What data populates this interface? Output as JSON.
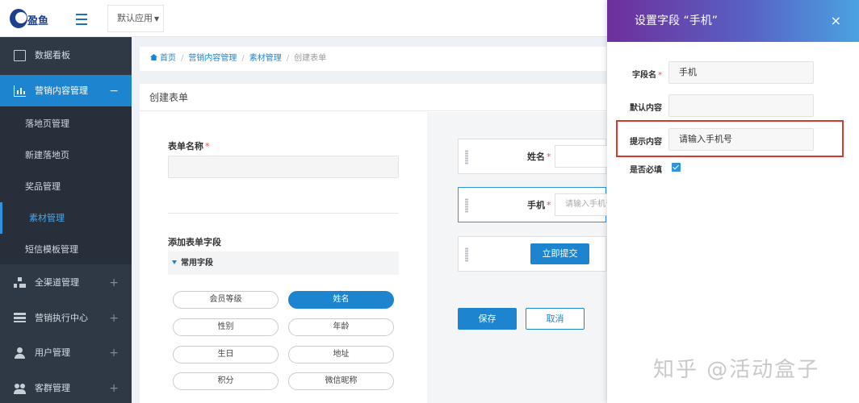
{
  "header": {
    "logo_text": "盈鱼",
    "app_select": "默认应用"
  },
  "sidebar": {
    "items": [
      {
        "label": "数据看板",
        "icon": "monitor-icon"
      },
      {
        "label": "营销内容管理",
        "icon": "chart-icon",
        "toggle": "−"
      },
      {
        "label": "全渠道管理",
        "icon": "sitemap-icon",
        "toggle": "+"
      },
      {
        "label": "营销执行中心",
        "icon": "stack-icon",
        "toggle": "+"
      },
      {
        "label": "用户管理",
        "icon": "user-icon",
        "toggle": "+"
      },
      {
        "label": "客群管理",
        "icon": "group-icon",
        "toggle": "+"
      }
    ],
    "submenu": [
      "落地页管理",
      "新建落地页",
      "奖品管理",
      "素材管理",
      "短信模板管理"
    ]
  },
  "breadcrumb": [
    "首页",
    "营销内容管理",
    "素材管理",
    "创建表单"
  ],
  "panel": {
    "title": "创建表单",
    "form_name_label": "表单名称",
    "required_mark": "*",
    "add_fields_label": "添加表单字段",
    "section_title": "常用字段",
    "fields": [
      "会员等级",
      "姓名",
      "性别",
      "年龄",
      "生日",
      "地址",
      "积分",
      "微信昵称"
    ]
  },
  "preview": {
    "name_label": "姓名",
    "phone_label": "手机",
    "phone_placeholder": "请输入手机号",
    "submit_label": "立即提交",
    "save_label": "保存",
    "cancel_label": "取消"
  },
  "drawer": {
    "title": "设置字段 “手机”",
    "close": "×",
    "field_name_label": "字段名",
    "field_name_value": "手机",
    "default_label": "默认内容",
    "default_value": "",
    "hint_label": "提示内容",
    "hint_value": "请输入手机号",
    "required_label": "是否必填",
    "required_checked": true
  },
  "watermark": "知乎 @活动盒子",
  "colors": {
    "primary": "#1d84cf",
    "sidebar_bg": "#2f3946",
    "highlight_border": "#d43b30"
  }
}
